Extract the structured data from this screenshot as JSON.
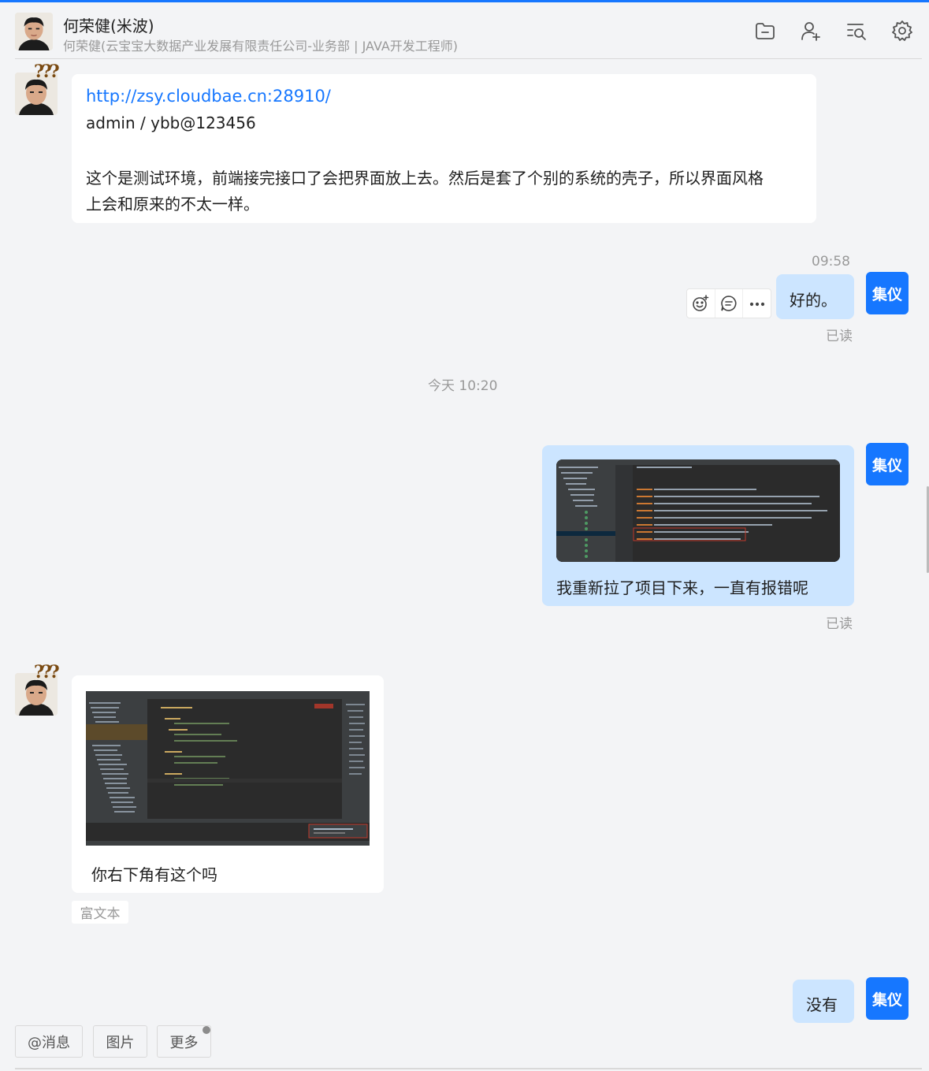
{
  "header": {
    "name": "何荣健(米波)",
    "subtitle": "何荣健(云宝宝大数据产业发展有限责任公司-业务部 | JAVA开发工程师)",
    "actions": [
      "folder-icon",
      "add-user-icon",
      "search-history-icon",
      "settings-icon"
    ]
  },
  "messages": {
    "m1": {
      "link": "http://zsy.cloudbae.cn:28910/",
      "line2": "admin / ybb@123456",
      "line3": "这个是测试环境，前端接完接口了会把界面放上去。然后是套了个别的系统的壳子，所以界面风格",
      "line4": "上会和原来的不太一样。"
    },
    "m2": {
      "time": "09:58",
      "text": "好的。",
      "status": "已读"
    },
    "separator_time": "今天 10:20",
    "m3": {
      "text": "我重新拉了项目下来，一直有报错呢",
      "status": "已读"
    },
    "m4": {
      "text": "你右下角有这个吗",
      "tag": "富文本"
    },
    "m5": {
      "text": "没有"
    }
  },
  "me": {
    "avatar_label": "集仪"
  },
  "toolbar": {
    "mention": "@消息",
    "image": "图片",
    "more": "更多"
  },
  "colors": {
    "accent": "#1677ff",
    "outgoing_bubble": "#cce5ff",
    "background": "#f3f4f6"
  }
}
